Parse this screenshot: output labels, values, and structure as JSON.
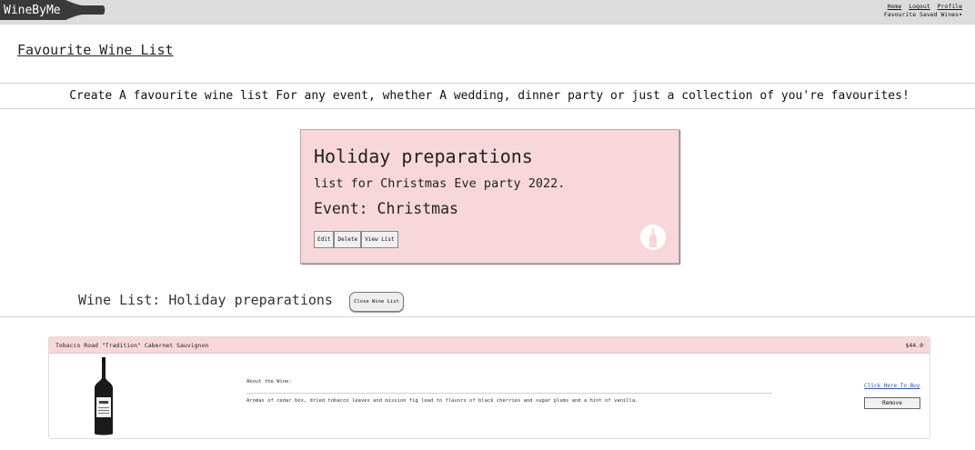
{
  "nav": {
    "logo_text": "WineByMe",
    "links": [
      "Home",
      "Logout",
      "Profile"
    ],
    "dropdown_label": "Favourite Saved Wines"
  },
  "page": {
    "title": "Favourite Wine List",
    "intro": "Create A favourite wine list For any event, whether A wedding, dinner party or just a collection of you're favourites!"
  },
  "list_card": {
    "title": "Holiday preparations",
    "description": "list for Christmas Eve party 2022.",
    "event": "Event: Christmas",
    "buttons": [
      "Edit",
      "Delete",
      "View List"
    ]
  },
  "wine_list": {
    "heading": "Wine List: Holiday preparations",
    "close_label": "Close Wine List",
    "items": [
      {
        "name": "Tobacco Road \"Tradition\" Cabernet Sauvignon",
        "price": "$44.0",
        "about_label": "About the Wine:",
        "about_text": "Aromas of cedar box, dried tobacco leaves and mission fig lead to flavors of black cherries and sugar plums and a hint of vanilla.",
        "buy_label": "Click Here To Buy",
        "remove_label": "Remove"
      }
    ]
  },
  "colors": {
    "card_bg": "#f8d7da",
    "topbar_bg": "#dcdcdc",
    "logo_bg": "#3a3a3a",
    "link_blue": "#1a55d6"
  }
}
